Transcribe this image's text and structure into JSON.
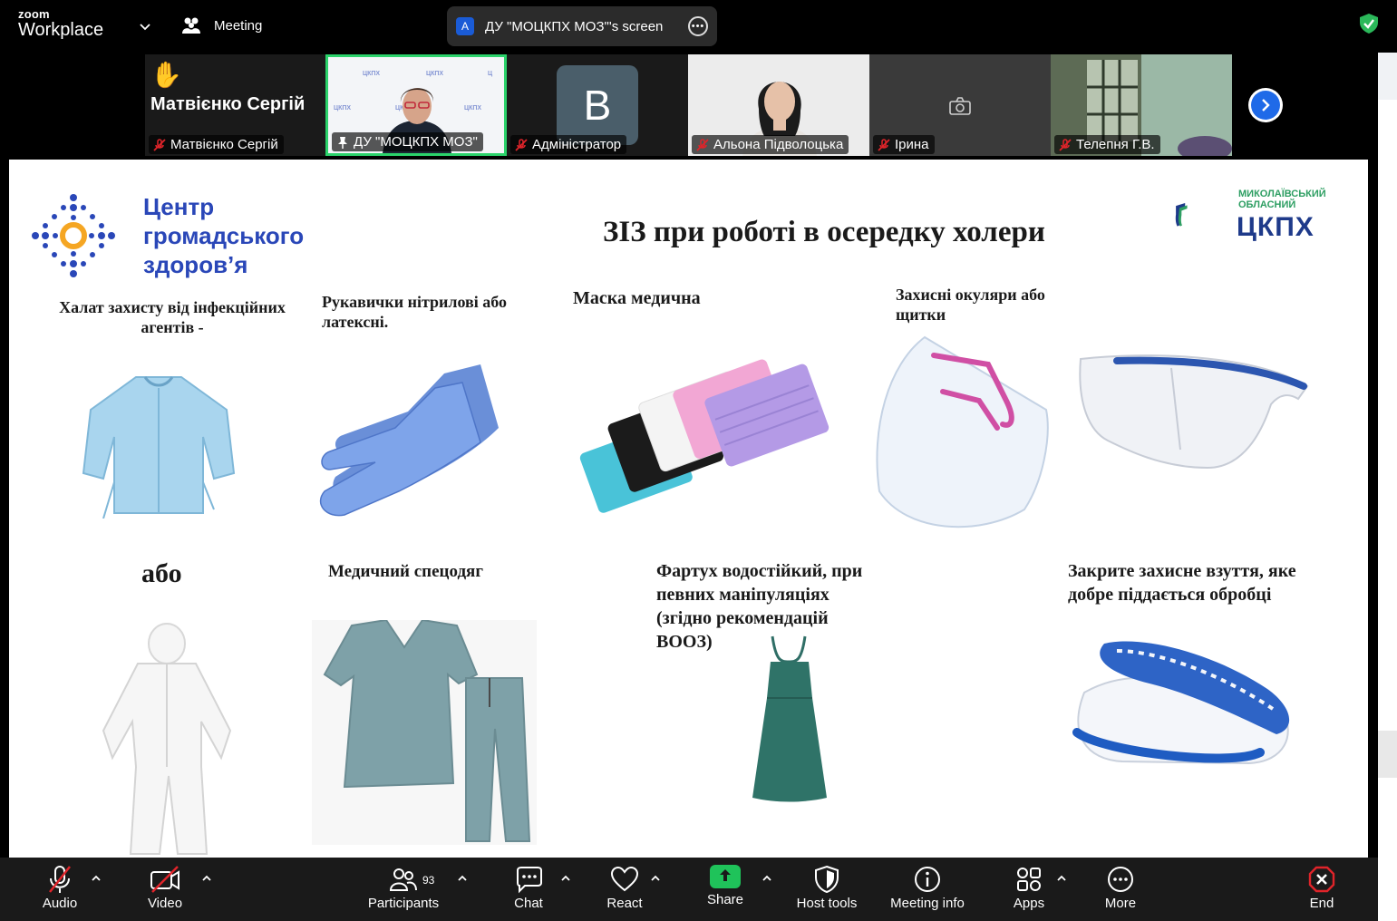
{
  "app": {
    "brand_small": "zoom",
    "brand_large": "Workplace",
    "meeting_label": "Meeting",
    "share_avatar": "A",
    "share_title": "ДУ \"МОЦКПХ МОЗ\"'s screen",
    "share_options_icon": "more-options-icon",
    "security_icon": "shield-check-icon",
    "security_color": "#2bb85a"
  },
  "participants": [
    {
      "name": "Матвієнко Сергій",
      "display": "Матвієнко Сергій",
      "hand_raised": true,
      "muted": true
    },
    {
      "name": "ДУ \"МОЦКПХ МОЗ\"",
      "active_speaker": true,
      "pinned": true
    },
    {
      "name": "Адміністратор",
      "avatar_letter": "B",
      "muted": true
    },
    {
      "name": "Альона Підволоцька",
      "muted": true
    },
    {
      "name": "Ірина",
      "muted": true
    },
    {
      "name": "Телепня Г.В.",
      "muted": true
    }
  ],
  "slide": {
    "logo_left_text": [
      "Центр",
      "громадського",
      "здоров’я"
    ],
    "title": "ЗІЗ при роботі в осередку холери",
    "logo_right_small": [
      "МИКОЛАЇВСЬКИЙ",
      "ОБЛАСНИЙ"
    ],
    "logo_right_big": "ЦКПХ",
    "items": {
      "gown": [
        "Халат  захисту від інфекційних",
        "агентів -"
      ],
      "gloves": [
        "Рукавички нітрилові або",
        "латексні."
      ],
      "mask": "Маска медична",
      "goggles": [
        "Захисні окуляри  або",
        "щитки"
      ],
      "or": "або",
      "scrubs": "Медичний спецодяг",
      "apron": [
        "Фартух водостійкий, при",
        "певних маніпуляціях",
        "(згідно рекомендацій",
        "ВООЗ)"
      ],
      "shoes": [
        "Закрите захисне взуття, яке",
        "добре піддається обробці"
      ]
    }
  },
  "toolbar": {
    "audio": "Audio",
    "video": "Video",
    "participants": "Participants",
    "participants_count": "93",
    "chat": "Chat",
    "react": "React",
    "share": "Share",
    "host_tools": "Host tools",
    "meeting_info": "Meeting info",
    "apps": "Apps",
    "more": "More",
    "end": "End",
    "end_color": "#e0242a",
    "share_color": "#1fc35a"
  }
}
